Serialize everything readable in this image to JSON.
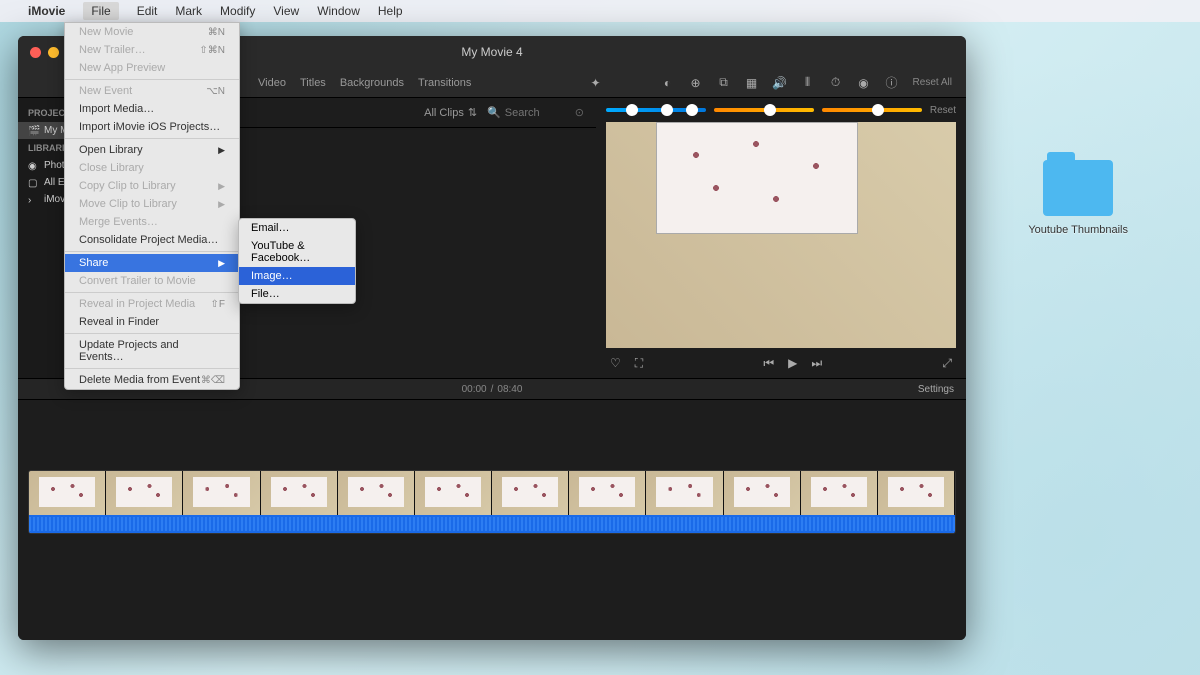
{
  "menubar": {
    "app": "iMovie",
    "items": [
      "File",
      "Edit",
      "Mark",
      "Modify",
      "View",
      "Window",
      "Help"
    ]
  },
  "file_menu": {
    "groups": [
      [
        {
          "label": "New Movie",
          "shortcut": "⌘N",
          "disabled": true
        },
        {
          "label": "New Trailer…",
          "shortcut": "⇧⌘N",
          "disabled": true
        },
        {
          "label": "New App Preview",
          "disabled": true
        }
      ],
      [
        {
          "label": "New Event",
          "shortcut": "⌥N",
          "disabled": true
        },
        {
          "label": "Import Media…"
        },
        {
          "label": "Import iMovie iOS Projects…"
        }
      ],
      [
        {
          "label": "Open Library",
          "arrow": true
        },
        {
          "label": "Close Library",
          "disabled": true
        },
        {
          "label": "Copy Clip to Library",
          "arrow": true,
          "disabled": true
        },
        {
          "label": "Move Clip to Library",
          "arrow": true,
          "disabled": true
        },
        {
          "label": "Merge Events…",
          "disabled": true
        },
        {
          "label": "Consolidate Project Media…"
        }
      ],
      [
        {
          "label": "Share",
          "arrow": true,
          "highlight": true
        },
        {
          "label": "Convert Trailer to Movie",
          "disabled": true
        }
      ],
      [
        {
          "label": "Reveal in Project Media",
          "shortcut": "⇧F",
          "disabled": true
        },
        {
          "label": "Reveal in Finder"
        }
      ],
      [
        {
          "label": "Update Projects and Events…"
        }
      ],
      [
        {
          "label": "Delete Media from Event",
          "shortcut": "⌘⌫"
        }
      ]
    ]
  },
  "share_submenu": {
    "items": [
      {
        "label": "Email…"
      },
      {
        "label": "YouTube & Facebook…"
      },
      {
        "label": "Image…",
        "selected": true
      },
      {
        "label": "File…"
      }
    ]
  },
  "window": {
    "title": "My Movie 4"
  },
  "topbar": {
    "tabs": [
      "Video",
      "Titles",
      "Backgrounds",
      "Transitions"
    ],
    "reset": "Reset All"
  },
  "sidebar": {
    "header1": "PROJECT M",
    "selected": "My M",
    "header2": "LIBRARIES",
    "items": [
      "Phot",
      "All E",
      "iMovie L"
    ]
  },
  "clips": {
    "label": "All Clips",
    "search_placeholder": "Search"
  },
  "sliders": {
    "reset": "Reset"
  },
  "time": {
    "current": "00:00",
    "total": "08:40"
  },
  "timeline_bar": {
    "settings": "Settings"
  },
  "desktop": {
    "folder_label": "Youtube Thumbnails"
  }
}
